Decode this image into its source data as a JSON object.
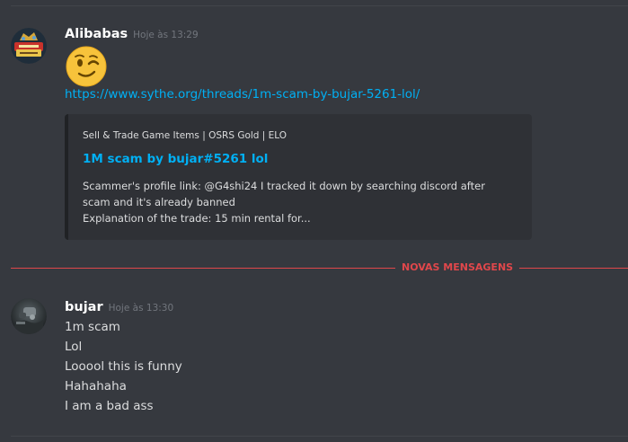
{
  "messages": [
    {
      "username": "Alibabas",
      "timestamp": "Hoje às 13:29",
      "avatar_icon": "alibabas-gold-logo-avatar",
      "emoji": "winking-face-emoji",
      "link": "https://www.sythe.org/threads/1m-scam-by-bujar-5261-lol/",
      "embed": {
        "provider": "Sell & Trade Game Items | OSRS Gold | ELO",
        "title": "1M scam by bujar#5261 lol",
        "description_lines": [
          "Scammer's profile link: @G4shi24 I tracked it down by searching discord after",
          "scam and it's already banned",
          "Explanation of the trade: 15 min rental for..."
        ]
      }
    },
    {
      "username": "bujar",
      "timestamp": "Hoje às 13:30",
      "avatar_icon": "user-photo-avatar",
      "lines": [
        "1m scam",
        "Lol",
        "Looool this is funny",
        "Hahahaha",
        "I am a bad ass"
      ]
    }
  ],
  "divider": {
    "label": "NOVAS MENSAGENS"
  },
  "colors": {
    "background": "#36393f",
    "embed_background": "#2f3136",
    "link": "#00b0f4",
    "new_messages": "#e0474b",
    "text": "#dcddde",
    "timestamp": "#72767d"
  }
}
